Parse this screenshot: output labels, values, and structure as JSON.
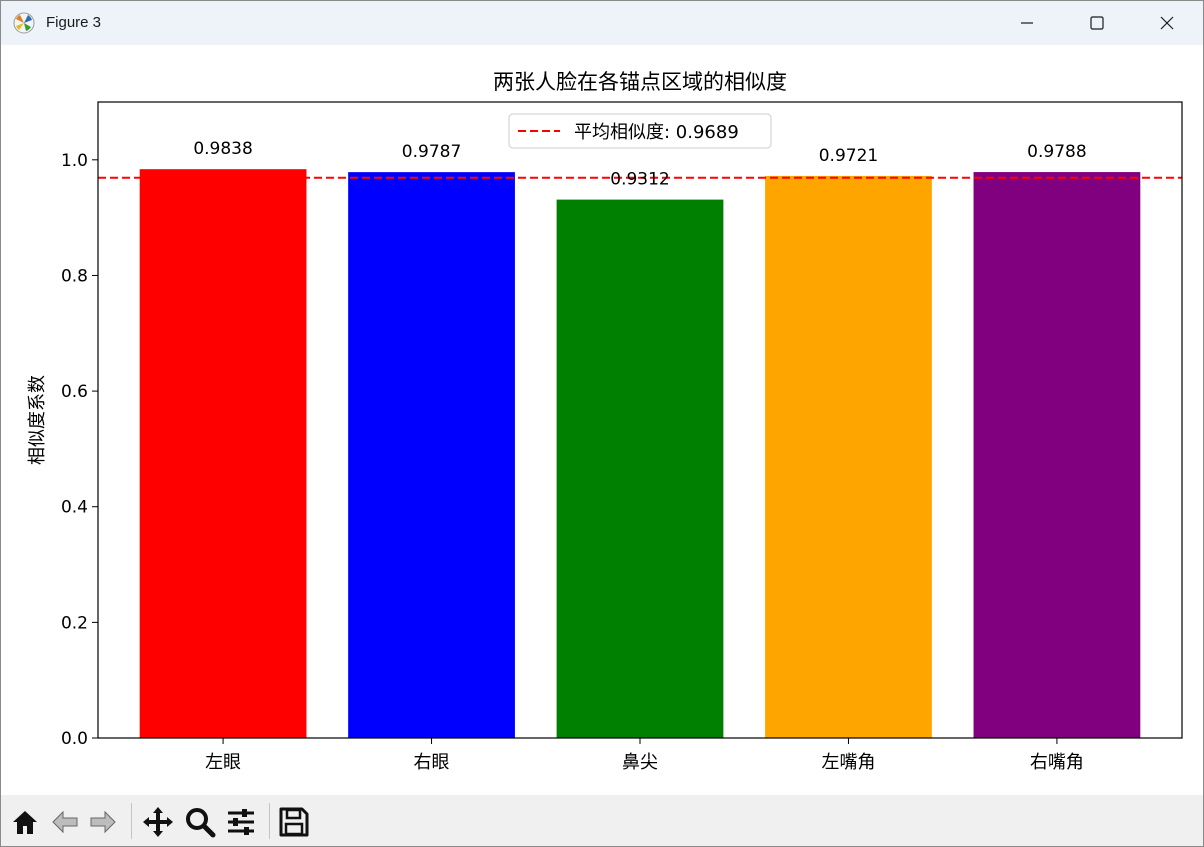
{
  "window": {
    "title": "Figure 3",
    "controls": [
      "minimize-icon",
      "maximize-icon",
      "close-icon"
    ]
  },
  "toolbar": {
    "tools": [
      "home-icon",
      "back-arrow-icon",
      "forward-arrow-icon",
      "pan-icon",
      "zoom-icon",
      "configure-subplots-icon",
      "save-icon"
    ]
  },
  "chart_data": {
    "type": "bar",
    "title": "两张人脸在各锚点区域的相似度",
    "xlabel": "",
    "ylabel": "相似度系数",
    "categories": [
      "左眼",
      "右眼",
      "鼻尖",
      "左嘴角",
      "右嘴角"
    ],
    "values": [
      0.9838,
      0.9787,
      0.9312,
      0.9721,
      0.9788
    ],
    "value_labels": [
      "0.9838",
      "0.9787",
      "0.9312",
      "0.9721",
      "0.9788"
    ],
    "colors": [
      "#ff0000",
      "#0000ff",
      "#008000",
      "#ffa500",
      "#800080"
    ],
    "ylim": [
      0,
      1.1
    ],
    "yticks": [
      0.0,
      0.2,
      0.4,
      0.6,
      0.8,
      1.0
    ],
    "ytick_labels": [
      "0.0",
      "0.2",
      "0.4",
      "0.6",
      "0.8",
      "1.0"
    ],
    "reference_line": {
      "value": 0.9689,
      "color": "#ff0000",
      "style": "dashed"
    },
    "legend": {
      "entries": [
        "平均相似度: 0.9689"
      ],
      "placement": "top-center"
    },
    "grid": false
  }
}
